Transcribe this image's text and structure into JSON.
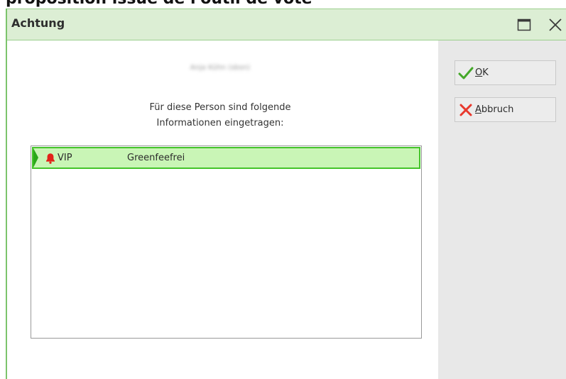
{
  "page_heading": "proposition issue de l'outil de vote",
  "dialog": {
    "title": "Achtung",
    "maximize_icon": "maximize-icon",
    "close_icon": "close-icon"
  },
  "content": {
    "blurred_name": "Anja Kühn (sbsn)",
    "message_line1": "Für diese Person sind folgende",
    "message_line2": "Informationen eingetragen:"
  },
  "info_list": {
    "rows": [
      {
        "icon": "bell-icon",
        "label": "VIP",
        "value": "Greenfeefrei"
      }
    ]
  },
  "buttons": {
    "ok": {
      "icon": "checkmark-icon",
      "mnemonic": "O",
      "rest": "K"
    },
    "cancel": {
      "icon": "x-icon",
      "mnemonic": "A",
      "rest": "bbruch"
    }
  },
  "colors": {
    "titlebar_bg": "#dceed4",
    "selection_bg": "#c9f5b6",
    "selection_border": "#44c42a",
    "ok_green": "#44a829",
    "cancel_red": "#e8382c",
    "bell_red": "#e2231a"
  }
}
